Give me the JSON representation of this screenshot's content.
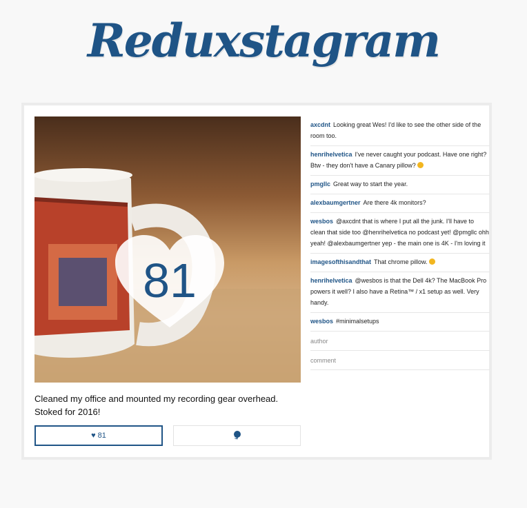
{
  "app": {
    "title": "Reduxstagram"
  },
  "post": {
    "caption": "Cleaned my office and mounted my recording gear overhead. Stoked for 2016!",
    "likes": "81",
    "like_button_label": "♥ 81",
    "comment_count": "9"
  },
  "comments": [
    {
      "user": "axcdnt",
      "text": "Looking great Wes! I'd like to see the other side of the room too."
    },
    {
      "user": "henrihelvetica",
      "text": "I've never caught your podcast. Have one right? Btw - they don't have a Canary pillow? ",
      "emoji": "grinning-emoji-icon"
    },
    {
      "user": "pmgllc",
      "text": "Great way to start the year."
    },
    {
      "user": "alexbaumgertner",
      "text": "Are there 4k monitors?"
    },
    {
      "user": "wesbos",
      "text": "@axcdnt that is where I put all the junk. I'll have to clean that side too @henrihelvetica no podcast yet! @pmgllc ohh yeah! @alexbaumgertner yep - the main one is 4K - I'm loving it"
    },
    {
      "user": "imagesofthisandthat",
      "text": "That chrome pillow. ",
      "emoji": "smile-emoji-icon"
    },
    {
      "user": "henrihelvetica",
      "text": "@wesbos is that the Dell 4k? The MacBook Pro powers it well? I also have a Retina™ / x1 setup as well. Very handy."
    },
    {
      "user": "wesbos",
      "text": "#minimalsetups"
    }
  ],
  "form": {
    "author_placeholder": "author",
    "comment_placeholder": "comment"
  },
  "colors": {
    "brand": "#1f5486",
    "background": "#f8f8f8",
    "card": "#ffffff"
  }
}
